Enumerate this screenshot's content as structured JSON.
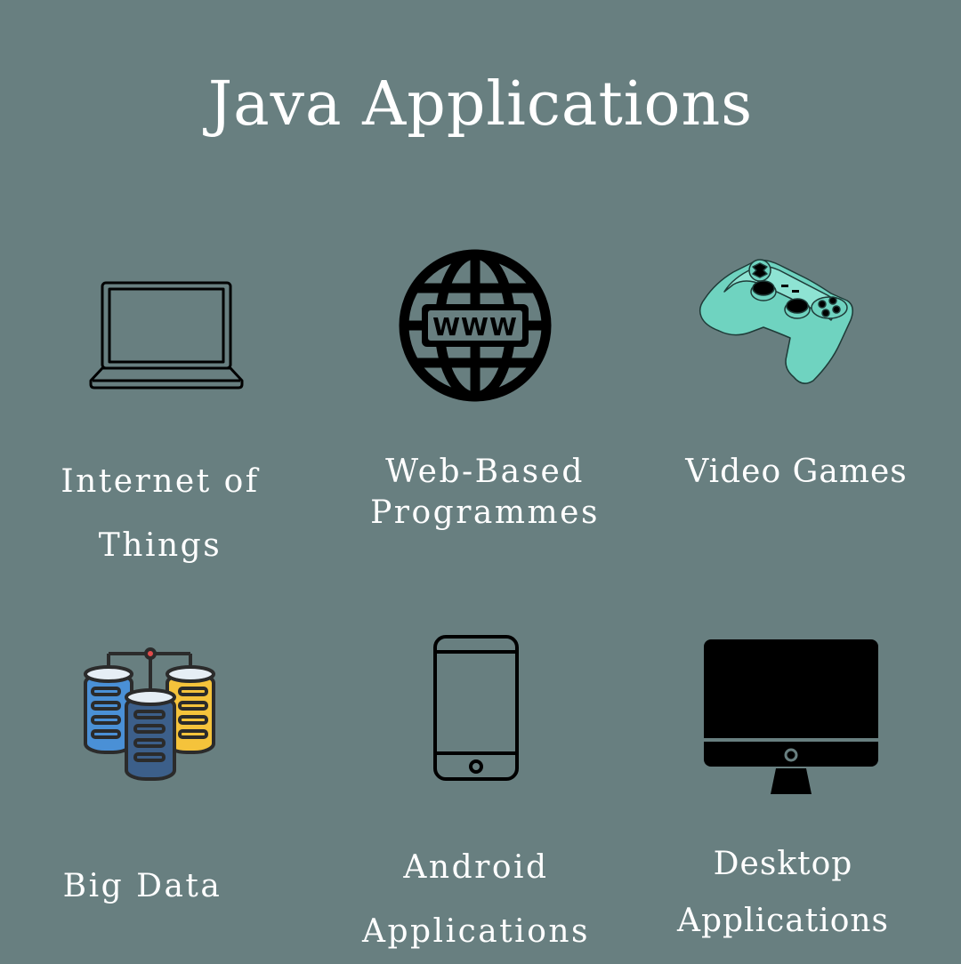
{
  "title": "Java Applications",
  "colors": {
    "background": "#687f80",
    "text": "#ffffff",
    "controller": "#6fd3c0",
    "db_blue": "#4a90d6",
    "db_dark": "#3c5f8a",
    "db_yellow": "#f5c33b",
    "dot_red": "#e14b4b"
  },
  "items": [
    {
      "icon": "laptop-icon",
      "label_lines": [
        "Internet of",
        "Things"
      ]
    },
    {
      "icon": "globe-www-icon",
      "label_lines": [
        "Web-Based",
        "Programmes"
      ],
      "icon_text": "WWW"
    },
    {
      "icon": "gamepad-icon",
      "label_lines": [
        "Video Games"
      ]
    },
    {
      "icon": "database-icon",
      "label_lines": [
        "Big Data"
      ]
    },
    {
      "icon": "smartphone-icon",
      "label_lines": [
        "Android",
        "Applications"
      ]
    },
    {
      "icon": "desktop-monitor-icon",
      "label_lines": [
        "Desktop",
        "Applications"
      ]
    }
  ]
}
